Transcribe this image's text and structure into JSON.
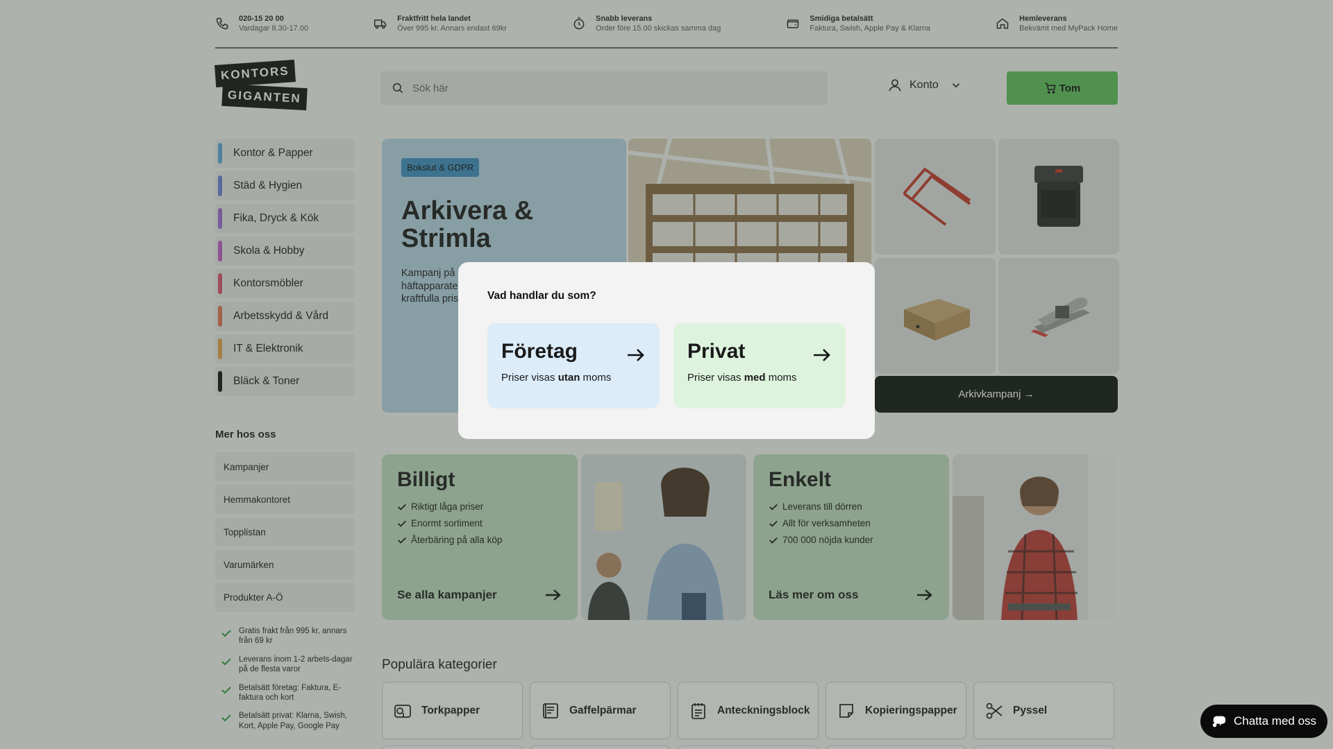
{
  "infobar": [
    {
      "icon": "phone-icon",
      "title": "020-15 20 00",
      "sub": "Vardagar 8.30-17.00"
    },
    {
      "icon": "truck-icon",
      "title": "Fraktfritt hela landet",
      "sub": "Över 995 kr. Annars endast 69kr"
    },
    {
      "icon": "stopwatch-icon",
      "title": "Snabb leverans",
      "sub": "Order före 15.00 skickas samma dag"
    },
    {
      "icon": "wallet-icon",
      "title": "Smidiga betalsätt",
      "sub": "Faktura, Swish, Apple Pay & Klarna"
    },
    {
      "icon": "home-icon",
      "title": "Hemleverans",
      "sub": "Bekvämt med MyPack Home"
    }
  ],
  "logo": {
    "line1": "KONTORS",
    "line2": "GIGANTEN"
  },
  "search": {
    "placeholder": "Sök här"
  },
  "account": {
    "label": "Konto"
  },
  "cart": {
    "label": "Tom"
  },
  "categories": [
    {
      "label": "Kontor & Papper",
      "color": "#5aa9d6"
    },
    {
      "label": "Städ & Hygien",
      "color": "#6b7fd7"
    },
    {
      "label": "Fika, Dryck & Kök",
      "color": "#9a6bd4"
    },
    {
      "label": "Skola & Hobby",
      "color": "#c15bc9"
    },
    {
      "label": "Kontorsmöbler",
      "color": "#d9506e"
    },
    {
      "label": "Arbetsskydd & Vård",
      "color": "#e07350"
    },
    {
      "label": "IT & Elektronik",
      "color": "#e3a24a"
    },
    {
      "label": "Bläck & Toner",
      "color": "#111111"
    }
  ],
  "more": {
    "title": "Mer hos oss",
    "items": [
      "Kampanjer",
      "Hemmakontoret",
      "Topplistan",
      "Varumärken",
      "Produkter A-Ö"
    ]
  },
  "usps": [
    "Gratis frakt från 995 kr, annars från 69 kr",
    "Leverans inom 1-2 arbets-dagar på de flesta varor",
    "Betalsätt företag: Faktura, E-faktura och kort",
    "Betalsätt privat: Klarna, Swish, Kort, Apple Pay, Google Pay"
  ],
  "hero": {
    "badge": "Bokslut & GDPR",
    "title": "Arkivera & Strimla",
    "text": "Kampanj på alla pärmar, arkivboxar, hålslag, häftapparater, dokumentförstörare till kraftfulla priser",
    "cta": "Arkivkampanj →"
  },
  "cards": {
    "billigt": {
      "title": "Billigt",
      "items": [
        "Riktigt låga priser",
        "Enormt sortiment",
        "Återbäring på alla köp"
      ],
      "cta": "Se alla kampanjer"
    },
    "enkelt": {
      "title": "Enkelt",
      "items": [
        "Leverans till dörren",
        "Allt för verksamheten",
        "700 000 nöjda kunder"
      ],
      "cta": "Läs mer om oss"
    }
  },
  "popular": {
    "title": "Populära kategorier",
    "items": [
      {
        "label": "Torkpapper",
        "icon": "paper-roll-icon"
      },
      {
        "label": "Gaffelpärmar",
        "icon": "binder-icon"
      },
      {
        "label": "Anteckningsblock",
        "icon": "notepad-icon"
      },
      {
        "label": "Kopieringspapper",
        "icon": "copy-paper-icon"
      },
      {
        "label": "Pyssel",
        "icon": "scissors-icon"
      }
    ]
  },
  "modal": {
    "question": "Vad handlar du som?",
    "business": {
      "title": "Företag",
      "sub_pre": "Priser visas ",
      "sub_strong": "utan",
      "sub_post": " moms",
      "bg": "#dcecf8"
    },
    "private": {
      "title": "Privat",
      "sub_pre": "Priser visas ",
      "sub_strong": "med",
      "sub_post": " moms",
      "bg": "#def3de"
    }
  },
  "chat": {
    "label": "Chatta med oss"
  }
}
